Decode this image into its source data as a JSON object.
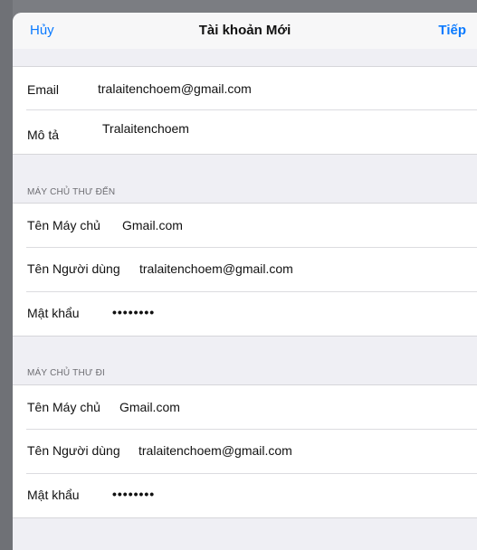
{
  "navbar": {
    "cancel_label": "Hủy",
    "title": "Tài khoản Mới",
    "next_label": "Tiếp"
  },
  "account": {
    "email_label": "Email",
    "email_value": "tralaitenchoem@gmail.com",
    "description_label": "Mô tả",
    "description_value": "Tralaitenchoem"
  },
  "incoming": {
    "header": "MÁY CHỦ THƯ ĐẾN",
    "host_label": "Tên Máy chủ",
    "host_value": "Gmail.com",
    "username_label": "Tên Người dùng",
    "username_value": "tralaitenchoem@gmail.com",
    "password_label": "Mật khẩu",
    "password_value": "••••••••"
  },
  "outgoing": {
    "header": "MÁY CHỦ THƯ ĐI",
    "host_label": "Tên Máy chủ",
    "host_value": "Gmail.com",
    "username_label": "Tên Người dùng",
    "username_value": "tralaitenchoem@gmail.com",
    "password_label": "Mật khẩu",
    "password_value": "••••••••"
  },
  "colors": {
    "accent": "#0a7aff",
    "sheet_background": "#efeff4",
    "row_background": "#ffffff",
    "backdrop": "#7b7d82"
  }
}
